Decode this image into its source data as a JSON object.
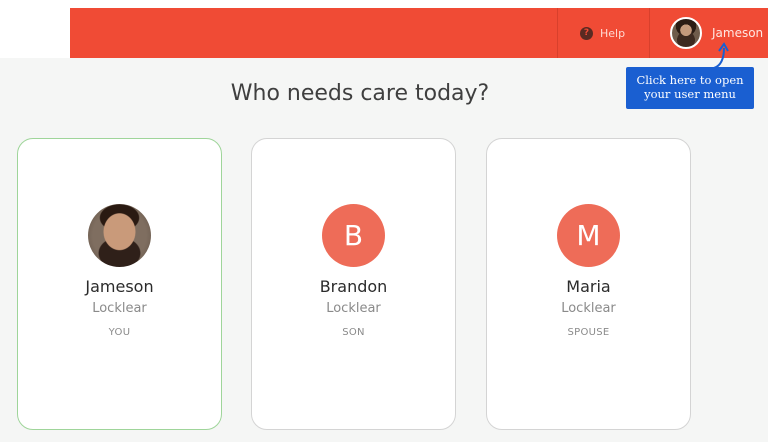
{
  "header": {
    "help_label": "Help",
    "help_icon": "question-circle-icon",
    "user_name": "Jameson",
    "accent_color": "#f04b35"
  },
  "tooltip": {
    "line1": "Click here to open",
    "line2": "your user menu",
    "color": "#1a5fd1"
  },
  "main": {
    "title": "Who needs care today?"
  },
  "people": [
    {
      "first": "Jameson",
      "last": "Locklear",
      "relation": "YOU",
      "avatar": "photo",
      "selected": true
    },
    {
      "first": "Brandon",
      "last": "Locklear",
      "relation": "SON",
      "initial": "B",
      "selected": false
    },
    {
      "first": "Maria",
      "last": "Locklear",
      "relation": "SPOUSE",
      "initial": "M",
      "selected": false
    }
  ]
}
